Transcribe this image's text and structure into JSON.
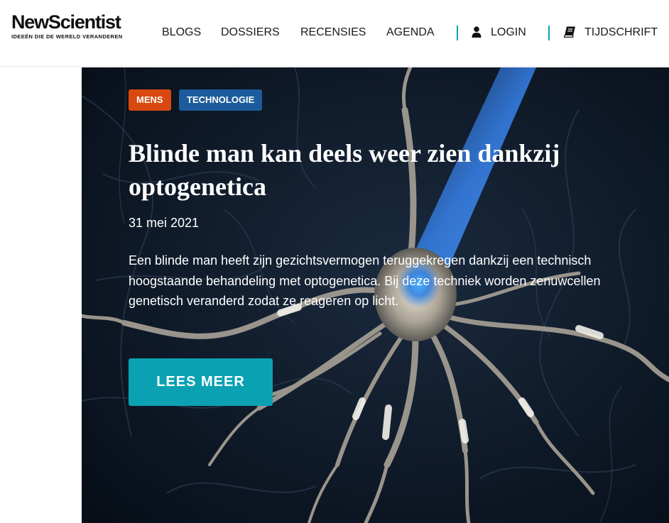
{
  "header": {
    "logo_name": "NewScientist",
    "logo_tagline": "IDEEËN DIE DE WERELD VERANDEREN",
    "nav": [
      {
        "label": "BLOGS"
      },
      {
        "label": "DOSSIERS"
      },
      {
        "label": "RECENSIES"
      },
      {
        "label": "AGENDA"
      }
    ],
    "login_label": "LOGIN",
    "login_icon": "user-icon",
    "magazine_label": "TIJDSCHRIFT",
    "magazine_icon": "book-icon",
    "divider_color": "#0aa2b3"
  },
  "hero": {
    "tags": [
      {
        "label": "MENS",
        "color": "#d9480f"
      },
      {
        "label": "TECHNOLOGIE",
        "color": "#1c5c9c"
      }
    ],
    "title": "Blinde man kan deels weer zien dankzij optogenetica",
    "date": "31 mei 2021",
    "summary": "Een blinde man heeft zijn gezichtsvermogen teruggekregen dankzij een technisch hoogstaande behandeling met optogenetica. Bij deze techniek worden zenuwcellen genetisch veranderd zodat ze reageren op licht.",
    "cta_label": "LEES MEER",
    "cta_color": "#0aa2b3",
    "background": "neuron illustration with blue light beam"
  }
}
